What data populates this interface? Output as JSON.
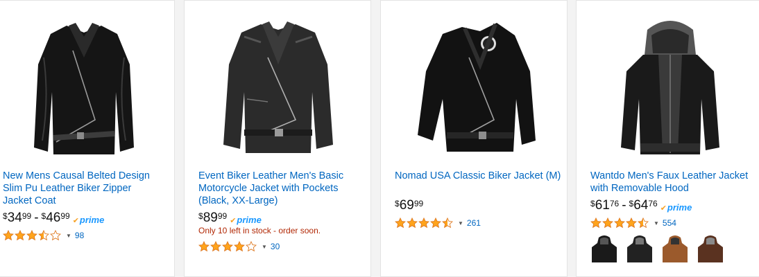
{
  "products": [
    {
      "title": "New Mens Causal Belted Design Slim Pu Leather Biker Zipper Jacket Coat",
      "price": {
        "symbol": "$",
        "low_whole": "34",
        "low_cents": "99",
        "dash": "-",
        "high_symbol": "$",
        "high_whole": "46",
        "high_cents": "99"
      },
      "prime": "prime",
      "rating": 3.5,
      "review_count": "98"
    },
    {
      "title": "Event Biker Leather Men's Basic Motorcycle Jacket with Pockets (Black, XX-Large)",
      "price": {
        "symbol": "$",
        "whole": "89",
        "cents": "99"
      },
      "prime": "prime",
      "stock_note": "Only 10 left in stock - order soon.",
      "rating": 4,
      "review_count": "30"
    },
    {
      "title": "Nomad USA Classic Biker Jacket (M)",
      "price": {
        "symbol": "$",
        "whole": "69",
        "cents": "99"
      },
      "rating": 4.5,
      "review_count": "261"
    },
    {
      "title": "Wantdo Men's Faux Leather Jacket with Removable Hood",
      "price": {
        "symbol": "$",
        "low_whole": "61",
        "low_cents": "76",
        "dash": "-",
        "high_symbol": "$",
        "high_whole": "64",
        "high_cents": "76"
      },
      "prime": "prime",
      "rating": 4.5,
      "review_count": "554",
      "swatches": [
        "black",
        "black-gray",
        "brown",
        "dark-brown"
      ]
    }
  ],
  "colors": {
    "link": "#0066c0",
    "star": "#ffa41c",
    "prime": "#1a98ff",
    "stock": "#b12704",
    "swatch_selected": "#e77600"
  },
  "icons": [
    "star-icon",
    "prime-check-icon",
    "caret-down-icon"
  ]
}
